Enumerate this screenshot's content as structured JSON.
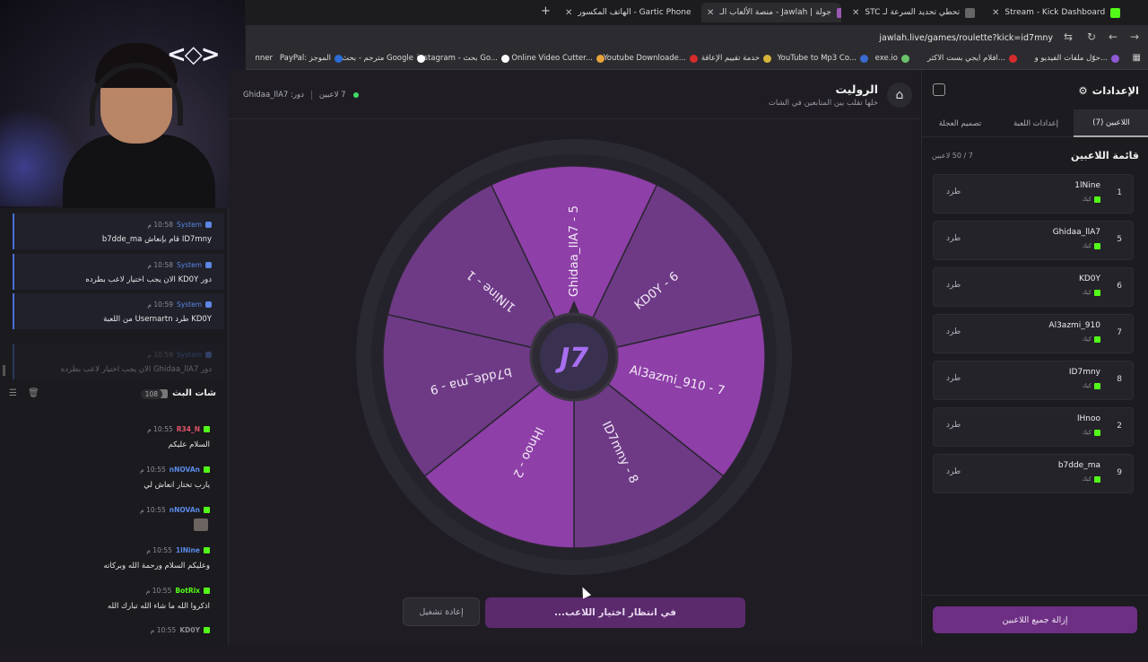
{
  "browser": {
    "tabs": [
      {
        "label": "Stream - Kick Dashboard",
        "active": false,
        "favicon": "kick-icon",
        "color": "#53fc18"
      },
      {
        "label": "تحطي تحديد السرعة لـ STC",
        "active": false,
        "favicon": "audio-icon",
        "color": "#888888"
      },
      {
        "label": "جولة | Jawlah - منصة الألعاب الـ",
        "active": true,
        "favicon": "jawlah-icon",
        "color": "#9b59b6"
      },
      {
        "label": "Gartic Phone - الهاتف المكسور",
        "active": false,
        "favicon": "phone-icon",
        "color": "#b36bd6"
      }
    ],
    "new_tab": "+",
    "url": "jawlah.live/games/roulette?kick=id7mny",
    "bookmarks": [
      {
        "label": "حوّل ملفات الفيديو و...",
        "color": "#8f5ad6"
      },
      {
        "label": "افلام ايجي بست الاكثر...",
        "color": "#d62b2b"
      },
      {
        "label": "exe.io",
        "color": "#6ac36a"
      },
      {
        "label": "YouTube to Mp3 Co...",
        "color": "#3a6bd1"
      },
      {
        "label": "خدمة تقييم الإعاقة",
        "color": "#d6b43a"
      },
      {
        "label": "Youtube Downloade...",
        "color": "#d62b2b"
      },
      {
        "label": "Online Video Cutter...",
        "color": "#e8a33a"
      },
      {
        "label": "instagram - بحث Go...",
        "color": "#ffffff"
      },
      {
        "label": "مترجم - بحث Google",
        "color": "#ffffff"
      },
      {
        "label": "PayPal: الموجز",
        "color": "#2b6cd6"
      },
      {
        "label": "nner",
        "color": "#aaaaaa"
      }
    ]
  },
  "chat": {
    "system_messages": [
      {
        "user": "System",
        "time": "10:58 م",
        "text": "ID7mny قام بإنعاش b7dde_ma",
        "faded": false
      },
      {
        "user": "System",
        "time": "10:58 م",
        "text": "دور KD0Y الان يجب اختيار لاعب بطرده",
        "faded": false
      },
      {
        "user": "System",
        "time": "10:59 م",
        "text": "KD0Y طرد Usernartn من اللعبة",
        "faded": false
      },
      {
        "user": "System",
        "time": "10:59 م",
        "text": "دور Ghidaa_llA7 الان يجب اختيار لاعب بطرده",
        "faded": true
      }
    ],
    "title": "شات البث",
    "count": "108",
    "messages": [
      {
        "user": "R34_N",
        "time": "10:55 م",
        "text": "السلام عليكم",
        "color": "#e0566a",
        "emote": false
      },
      {
        "user": "nNOVAn",
        "time": "10:55 م",
        "text": "يارب تختار انعاش لي",
        "color": "#5a8be8",
        "emote": false
      },
      {
        "user": "nNOVAn",
        "time": "10:55 م",
        "text": "",
        "color": "#5a8be8",
        "emote": true
      },
      {
        "user": "1lNine",
        "time": "10:55 م",
        "text": "وعليكم السلام ورحمة الله وبركاته",
        "color": "#5a8be8",
        "emote": false
      },
      {
        "user": "BotRix",
        "time": "10:55 م",
        "text": "اذكروا الله ما شاء الله تبارك الله",
        "color": "#53fc18",
        "emote": false
      },
      {
        "user": "KD0Y",
        "time": "10:55 م",
        "text": "",
        "color": "#8b8c93",
        "emote": false
      }
    ]
  },
  "main": {
    "title": "الروليت",
    "subtitle": "خلها تقلب بين المتابعين في الشات",
    "players_online": "7 لاعبين",
    "turn": "دور: Ghidaa_llA7",
    "restart_label": "إعادة تشغيل",
    "wait_label": "في انتظار اختيار اللاعب...",
    "wheel": {
      "segments": [
        {
          "label": "Ghidaa_llA7 - 5",
          "color": "#8e3fa8"
        },
        {
          "label": "KD0Y - 6",
          "color": "#6e3a86"
        },
        {
          "label": "Al3azmi_910 - 7",
          "color": "#8e3fa8"
        },
        {
          "label": "ID7mny - 8",
          "color": "#6e3a86"
        },
        {
          "label": "lHnoo - 2",
          "color": "#8e3fa8"
        },
        {
          "label": "b7dde_ma - 9",
          "color": "#6e3a86"
        },
        {
          "label": "1lNine - 1",
          "color": "#6e3a86"
        }
      ],
      "hub_logo": "J7",
      "rim_color": "#2a2830"
    }
  },
  "settings": {
    "title": "الإعدادات",
    "tabs": [
      {
        "label": "اللاعبين (7)",
        "active": true
      },
      {
        "label": "إعدادات اللعبة",
        "active": false
      },
      {
        "label": "تصميم العجلة",
        "active": false
      }
    ],
    "list_title": "قائمة اللاعبين",
    "list_count": "7 / 50 لاعبين",
    "players": [
      {
        "num": "1",
        "name": "1lNine",
        "platform": "كيك",
        "kick_label": "طرد"
      },
      {
        "num": "5",
        "name": "Ghidaa_llA7",
        "platform": "كيك",
        "kick_label": "طرد"
      },
      {
        "num": "6",
        "name": "KD0Y",
        "platform": "كيك",
        "kick_label": "طرد"
      },
      {
        "num": "7",
        "name": "Al3azmi_910",
        "platform": "كيك",
        "kick_label": "طرد"
      },
      {
        "num": "8",
        "name": "ID7mny",
        "platform": "كيك",
        "kick_label": "طرد"
      },
      {
        "num": "2",
        "name": "lHnoo",
        "platform": "كيك",
        "kick_label": "طرد"
      },
      {
        "num": "9",
        "name": "b7dde_ma",
        "platform": "كيك",
        "kick_label": "طرد"
      }
    ],
    "remove_all_label": "إزالة جميع اللاعبين"
  }
}
